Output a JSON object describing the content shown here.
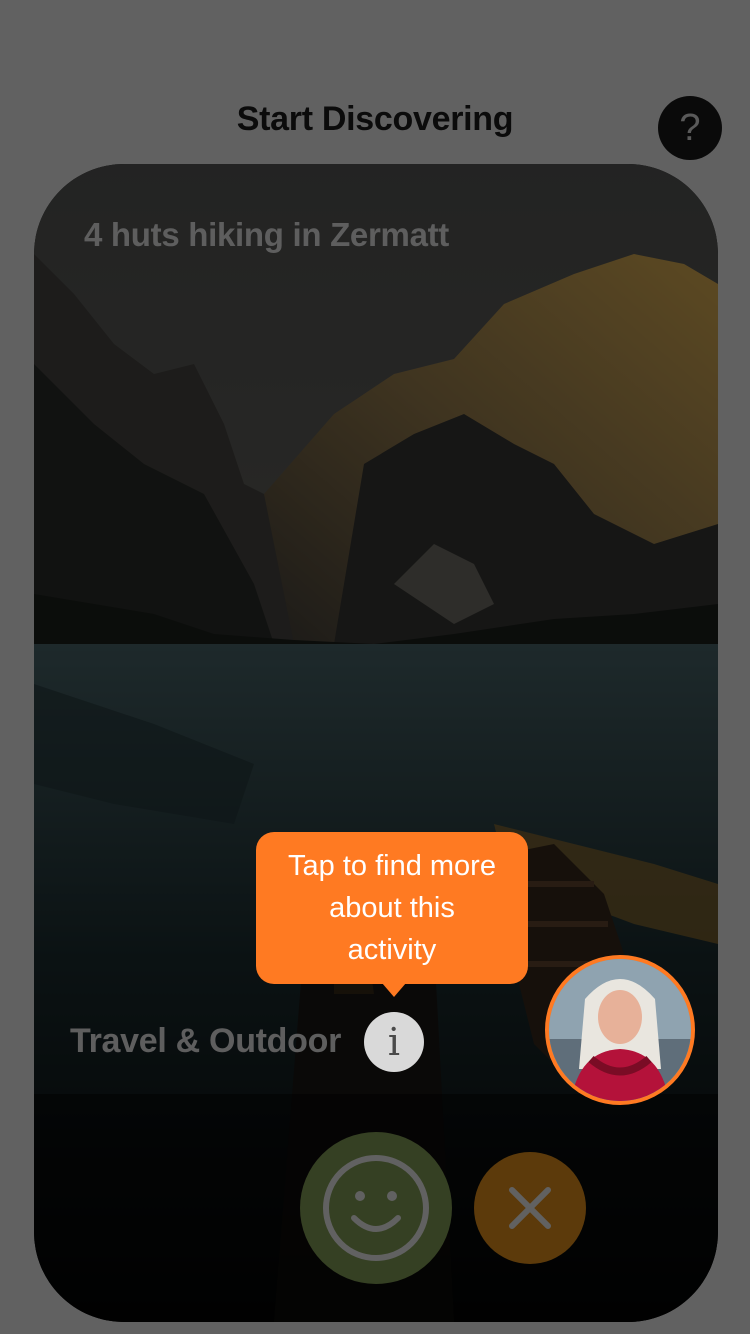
{
  "header": {
    "title": "Start Discovering",
    "help_icon": "question-mark-icon",
    "help_label": "?"
  },
  "card": {
    "title": "4 huts hiking in Zermatt",
    "category": "Travel & Outdoor",
    "info_label": "i"
  },
  "tooltip": {
    "text": "Tap to find more about this activity"
  },
  "actions": {
    "like_icon": "smiley-face-icon",
    "dismiss_icon": "close-icon"
  },
  "avatar": {
    "icon": "user-avatar"
  },
  "colors": {
    "accent": "#ff7a22",
    "like": "#8ca85c",
    "dismiss": "#f29a1e",
    "overlay": "rgba(0,0,0,0.62)"
  }
}
